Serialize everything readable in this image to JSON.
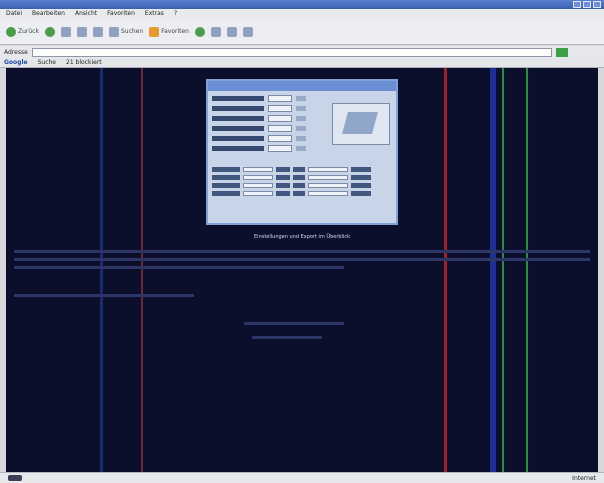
{
  "window": {
    "title": ""
  },
  "menu": {
    "items": [
      "Datei",
      "Bearbeiten",
      "Ansicht",
      "Favoriten",
      "Extras",
      "?"
    ]
  },
  "toolbar": {
    "back_label": "Zurück",
    "search_label": "Suchen",
    "favorites_label": "Favoriten"
  },
  "address": {
    "label": "Adresse",
    "value": ""
  },
  "links": {
    "google_label": "Google",
    "search_label": "Suche",
    "blocked_label": "21 blockiert"
  },
  "page": {
    "caption": "Einstellungen und Export im Überblick"
  },
  "status": {
    "right_label": "Internet"
  },
  "colors": {
    "background": "#0b0f2b",
    "stripe_red": "#a3202a",
    "stripe_blue": "#1f2f9a",
    "stripe_green": "#2a8f3c"
  }
}
